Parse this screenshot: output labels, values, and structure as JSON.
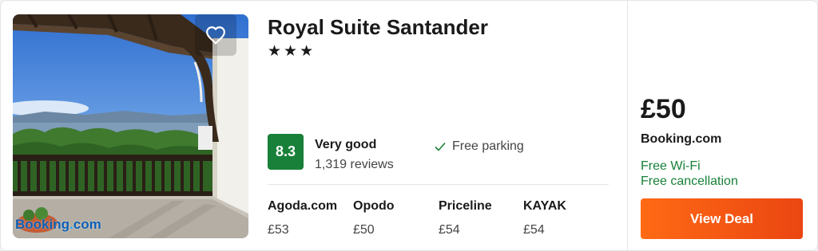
{
  "hotel": {
    "name": "Royal Suite Santander",
    "stars_text": "★★★",
    "star_count": 3,
    "photo_watermark": {
      "part1": "Booking",
      "dot": ".",
      "part2": "com"
    }
  },
  "rating": {
    "score": "8.3",
    "label": "Very good",
    "reviews": "1,319 reviews",
    "badge_color": "#188038"
  },
  "amenities": [
    {
      "label": "Free parking",
      "icon": "check-icon"
    }
  ],
  "providers": [
    {
      "name": "Agoda.com",
      "price": "£53"
    },
    {
      "name": "Opodo",
      "price": "£50"
    },
    {
      "name": "Priceline",
      "price": "£54"
    },
    {
      "name": "KAYAK",
      "price": "£54"
    }
  ],
  "deal": {
    "price": "£50",
    "site": "Booking.com",
    "perks": [
      "Free Wi-Fi",
      "Free cancellation"
    ],
    "perk_color": "#188038",
    "button_label": "View Deal",
    "button_color": "#ff5f0f"
  },
  "icons": {
    "favorite": "heart-icon"
  }
}
